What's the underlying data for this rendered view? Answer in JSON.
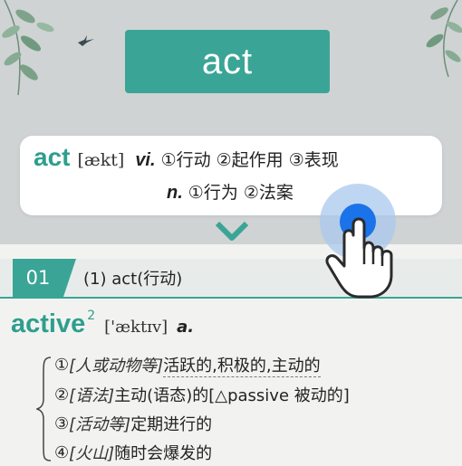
{
  "banner": {
    "word": "act"
  },
  "definition_card": {
    "headword": "act",
    "ipa": "[ækt]",
    "pos_verb": "vi.",
    "verb_meanings": "①行动 ②起作用 ③表现",
    "pos_noun": "n.",
    "noun_meanings": "①行为 ②法案"
  },
  "section": {
    "number": "01",
    "label": "(1) act(行动)"
  },
  "entry": {
    "headword": "active",
    "superscript": "2",
    "ipa": "['æktɪv]",
    "pos": "a.",
    "senses": [
      {
        "num": "①",
        "label": "[人或动物等]",
        "text": "活跃的,积极的,主动的"
      },
      {
        "num": "②",
        "label": "[语法]",
        "text": "主动(语态)的[△passive 被动的]"
      },
      {
        "num": "③",
        "label": "[活动等]",
        "text": "定期进行的"
      },
      {
        "num": "④",
        "label": "[火山]",
        "text": "随时会爆发的"
      }
    ]
  },
  "colors": {
    "teal": "#3aa596",
    "grey_band": "#cfd3d3",
    "tap_blue": "#1a73e8"
  },
  "icons": [
    "leaf-decoration-icon",
    "bird-icon",
    "chevron-down-icon",
    "tap-hand-icon"
  ]
}
